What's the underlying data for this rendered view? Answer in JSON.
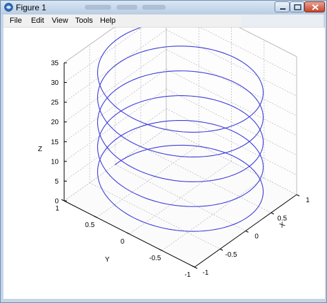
{
  "window": {
    "title": "Figure 1",
    "title_color": "#000000",
    "frame_color": "#c4d5e8"
  },
  "icons": {
    "app": "figure-app-icon",
    "minimize": "minimize-icon",
    "maximize": "maximize-icon",
    "close": "close-icon"
  },
  "menu": {
    "items": [
      "File",
      "Edit",
      "View",
      "Tools",
      "Help"
    ]
  },
  "chart_data": {
    "type": "line",
    "projection": "3d",
    "series": [
      {
        "color": "#3b3bdc",
        "parametric": {
          "x": "sin(t)",
          "y": "cos(t)",
          "z": "t",
          "t_range": [
            0,
            32
          ]
        }
      }
    ],
    "xlabel": "X",
    "ylabel": "Y",
    "zlabel": "Z",
    "xlim": [
      -1,
      1
    ],
    "ylim": [
      -1,
      1
    ],
    "zlim": [
      0,
      35
    ],
    "xticks": [
      "-1",
      "-0.5",
      "0",
      "0.5",
      "1"
    ],
    "yticks": [
      "1",
      "0.5",
      "0",
      "-0.5",
      "-1"
    ],
    "zticks": [
      "0",
      "5",
      "10",
      "15",
      "20",
      "25",
      "30",
      "35"
    ],
    "grid": true
  }
}
